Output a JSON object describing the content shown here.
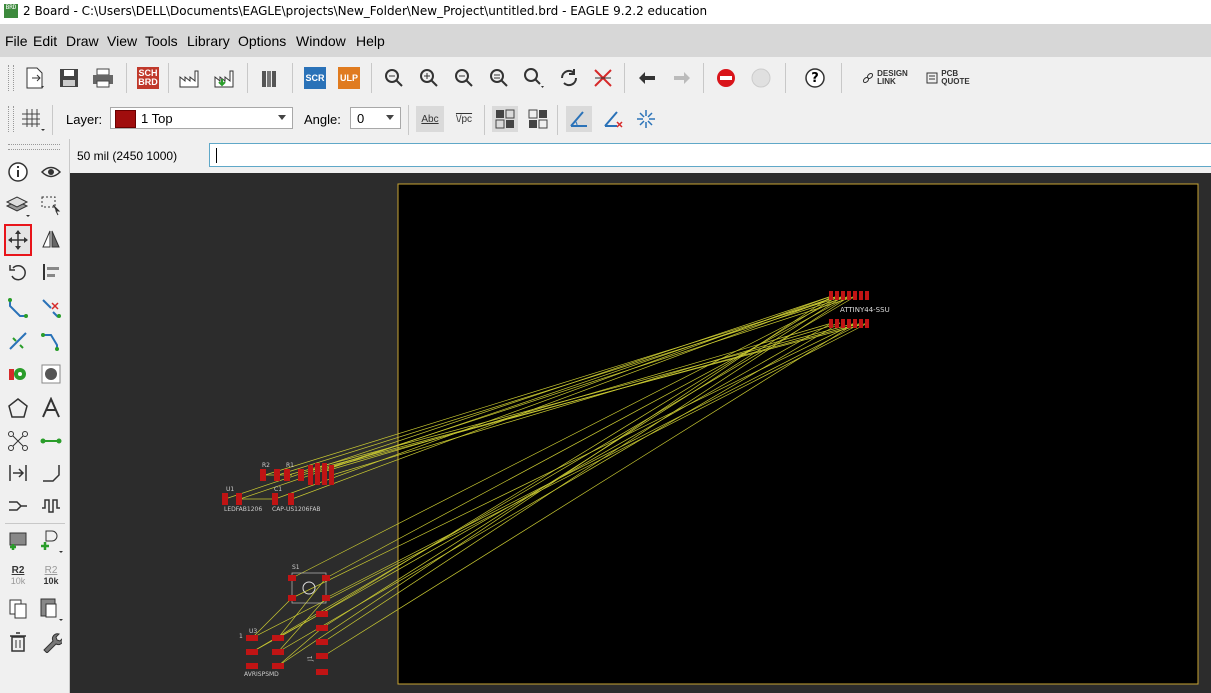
{
  "window": {
    "title": "2 Board - C:\\Users\\DELL\\Documents\\EAGLE\\projects\\New_Folder\\New_Project\\untitled.brd - EAGLE 9.2.2 education",
    "icon_text": "BRD"
  },
  "menu": [
    "File",
    "Edit",
    "Draw",
    "View",
    "Tools",
    "Library",
    "Options",
    "Window",
    "Help"
  ],
  "toolbar": {
    "sch_brd_top": "SCH",
    "sch_brd_bottom": "BRD",
    "scr": "SCR",
    "ulp": "ULP",
    "design_link_top": "DESIGN",
    "design_link_bottom": "LINK",
    "pcb_quote_top": "PCB",
    "pcb_quote_bottom": "QUOTE",
    "help": "?"
  },
  "params": {
    "layer_label": "Layer:",
    "layer_value": "1 Top",
    "layer_color": "#a00d0d",
    "angle_label": "Angle:",
    "angle_value": "0",
    "text_abc": "Abc",
    "text_vpc": "\\/pc"
  },
  "sidebar": {
    "r2_label": "R2",
    "r2_value": "10k",
    "r2b_label": "R2",
    "r2b_value": "10k"
  },
  "status": {
    "coordinate": "50 mil (2450 1000)",
    "command_value": ""
  },
  "board": {
    "labels": {
      "attiny": "ATTINY44-SSU",
      "r2": "R2",
      "r1": "R1",
      "c1": "C1",
      "u1": "U1",
      "ledfab": "LEDFAB1206",
      "cap": "CAP-US1206FAB",
      "s1": "S1",
      "u3": "U3",
      "avrisp": "AVRISPSMD",
      "j1": "J1",
      "pin1": "1"
    },
    "colors": {
      "background": "#2c2c2c",
      "board_fill": "#000000",
      "outline": "#c9a534",
      "pad": "#c01414",
      "airwire": "#c8c832"
    }
  }
}
